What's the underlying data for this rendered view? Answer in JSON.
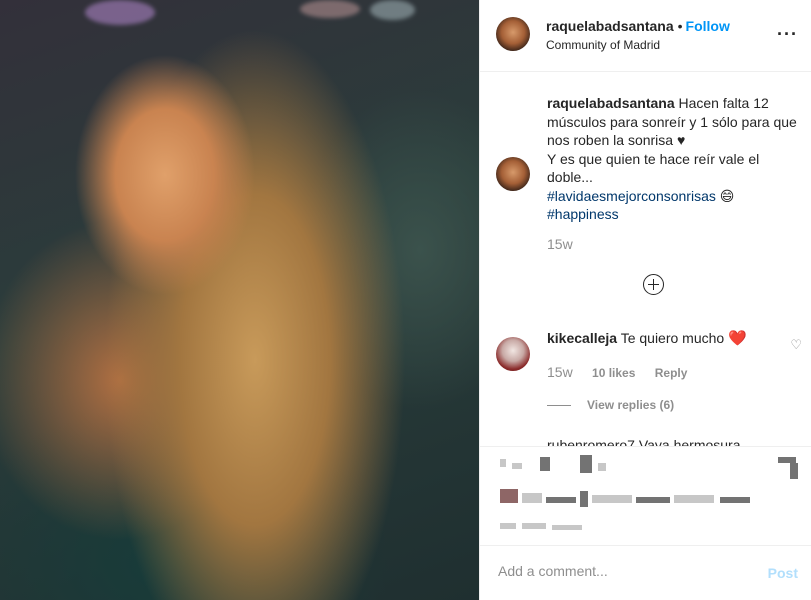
{
  "post": {
    "username": "raquelabadsantana",
    "follow_label": "Follow",
    "separator": "•",
    "location": "Community of Madrid",
    "more_label": "···"
  },
  "caption": {
    "username": "raquelabadsantana",
    "text": "Hacen falta 12 músculos para sonreír y 1 sólo para que nos roben la sonrisa ♥︎",
    "text2": "Y es que quien te hace reír vale el doble...",
    "hashtag1": "#lavidaesmejorconsonrisas",
    "emoji": "😄",
    "hashtag2": "#happiness",
    "time": "15w"
  },
  "comments": [
    {
      "username": "kikecalleja",
      "text": "Te quiero mucho",
      "emoji": "❤️",
      "time": "15w",
      "likes": "10 likes",
      "reply_label": "Reply",
      "view_replies": "View replies (6)"
    }
  ],
  "next_comment_partial": "rubenromero7 Vaya hermosura",
  "add_comment": {
    "placeholder": "Add a comment...",
    "post_label": "Post"
  },
  "colors": {
    "follow": "#0095f6",
    "hashtag": "#00376b",
    "heart": "#ed1c24",
    "post_disabled": "#b2dffc",
    "muted": "#8e8e8e"
  },
  "icons": [
    "more-options-icon",
    "load-more-comments-icon",
    "comment-like-heart-icon"
  ]
}
